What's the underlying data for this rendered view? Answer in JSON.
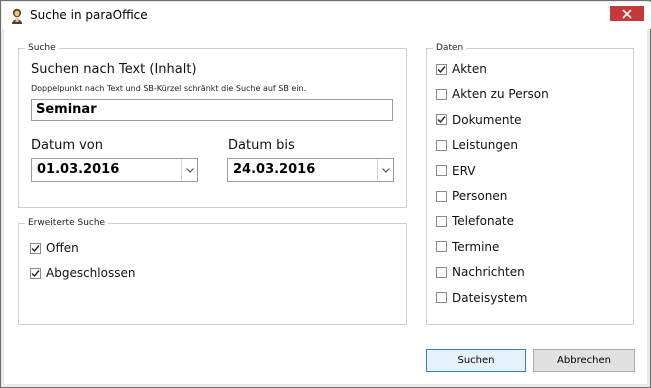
{
  "window": {
    "title": "Suche in paraOffice"
  },
  "search": {
    "group_label": "Suche",
    "text_label": "Suchen nach Text (Inhalt)",
    "hint": "Doppelpunkt nach Text und SB-Kürzel schränkt die Suche auf SB ein.",
    "text_value": "Seminar",
    "date_from_label": "Datum von",
    "date_from_value": "01.03.2016",
    "date_to_label": "Datum bis",
    "date_to_value": "24.03.2016"
  },
  "advanced": {
    "group_label": "Erweiterte Suche",
    "options": [
      {
        "label": "Offen",
        "checked": true
      },
      {
        "label": "Abgeschlossen",
        "checked": true
      }
    ]
  },
  "data": {
    "group_label": "Daten",
    "options": [
      {
        "label": "Akten",
        "checked": true
      },
      {
        "label": "Akten zu Person",
        "checked": false
      },
      {
        "label": "Dokumente",
        "checked": true
      },
      {
        "label": "Leistungen",
        "checked": false
      },
      {
        "label": "ERV",
        "checked": false
      },
      {
        "label": "Personen",
        "checked": false
      },
      {
        "label": "Telefonate",
        "checked": false
      },
      {
        "label": "Termine",
        "checked": false
      },
      {
        "label": "Nachrichten",
        "checked": false
      },
      {
        "label": "Dateisystem",
        "checked": false
      }
    ]
  },
  "buttons": {
    "search": "Suchen",
    "cancel": "Abbrechen"
  },
  "colors": {
    "close": "#c7383a",
    "primary_border": "#3c7fb1"
  }
}
